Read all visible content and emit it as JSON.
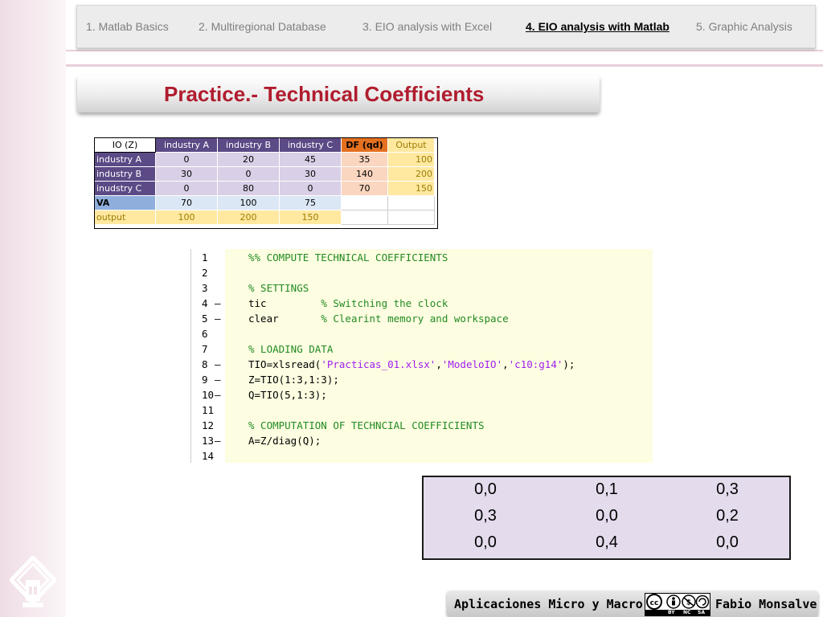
{
  "nav": {
    "items": [
      {
        "label": "1. Matlab Basics",
        "active": false
      },
      {
        "label": "2. Multiregional Database",
        "active": false
      },
      {
        "label": "3. EIO analysis with Excel",
        "active": false
      },
      {
        "label": "4. EIO analysis with Matlab",
        "active": true
      },
      {
        "label": "5. Graphic Analysis",
        "active": false
      }
    ]
  },
  "title": "Practice.- Technical Coefficients",
  "io_table": {
    "header": [
      "IO (Z)",
      "industry A",
      "industry B",
      "industry C",
      "DF (qd)",
      "Output"
    ],
    "rows": [
      {
        "label": "industry A",
        "cells": [
          "0",
          "20",
          "45",
          "35",
          "100"
        ]
      },
      {
        "label": "industry B",
        "cells": [
          "30",
          "0",
          "30",
          "140",
          "200"
        ]
      },
      {
        "label": "inudstry C",
        "cells": [
          "0",
          "80",
          "0",
          "70",
          "150"
        ]
      },
      {
        "label": "VA",
        "cells": [
          "70",
          "100",
          "75",
          "",
          ""
        ]
      },
      {
        "label": "output",
        "cells": [
          "100",
          "200",
          "150",
          "",
          ""
        ]
      }
    ]
  },
  "code": {
    "lines": [
      {
        "n": "1",
        "dash": "",
        "parts": [
          [
            "comment",
            "%% COMPUTE TECHNICAL COEFFICIENTS"
          ]
        ]
      },
      {
        "n": "2",
        "dash": "",
        "parts": []
      },
      {
        "n": "3",
        "dash": "",
        "parts": [
          [
            "comment",
            "% SETTINGS"
          ]
        ]
      },
      {
        "n": "4",
        "dash": "–",
        "parts": [
          [
            "code",
            "tic         "
          ],
          [
            "comment",
            "% Switching the clock"
          ]
        ]
      },
      {
        "n": "5",
        "dash": "–",
        "parts": [
          [
            "code",
            "clear       "
          ],
          [
            "comment",
            "% Clearint memory and workspace"
          ]
        ]
      },
      {
        "n": "6",
        "dash": "",
        "parts": []
      },
      {
        "n": "7",
        "dash": "",
        "parts": [
          [
            "comment",
            "% LOADING DATA"
          ]
        ]
      },
      {
        "n": "8",
        "dash": "–",
        "parts": [
          [
            "code",
            "TIO=xlsread("
          ],
          [
            "str",
            "'Practicas_01.xlsx'"
          ],
          [
            "code",
            ","
          ],
          [
            "str",
            "'ModeloIO'"
          ],
          [
            "code",
            ","
          ],
          [
            "str",
            "'c10:g14'"
          ],
          [
            "code",
            ");"
          ]
        ]
      },
      {
        "n": "9",
        "dash": "–",
        "parts": [
          [
            "code",
            "Z=TIO(1:3,1:3);"
          ]
        ]
      },
      {
        "n": "10",
        "dash": "–",
        "parts": [
          [
            "code",
            "Q=TIO(5,1:3);"
          ]
        ]
      },
      {
        "n": "11",
        "dash": "",
        "parts": []
      },
      {
        "n": "12",
        "dash": "",
        "parts": [
          [
            "comment",
            "% COMPUTATION OF TECHNCIAL COEFFICIENTS"
          ]
        ]
      },
      {
        "n": "13",
        "dash": "–",
        "parts": [
          [
            "code",
            "A=Z/diag(Q);"
          ]
        ]
      },
      {
        "n": "14",
        "dash": "",
        "parts": []
      }
    ]
  },
  "result": {
    "rows": [
      [
        "0,0",
        "0,1",
        "0,3"
      ],
      [
        "0,3",
        "0,0",
        "0,2"
      ],
      [
        "0,0",
        "0,4",
        "0,0"
      ]
    ]
  },
  "footer": {
    "left_text": "Aplicaciones Micro y Macro",
    "right_text": "Fabio Monsalve",
    "license_labels": [
      "BY",
      "NC",
      "SA"
    ]
  },
  "colors": {
    "title": "#b01c2e",
    "row_label_bg": "#5c4a86",
    "matrix_bg": "#d9cfe6",
    "df_header_bg": "#e5701f",
    "df_bg": "#fad5bf",
    "output_bg": "#ffe8a0",
    "va_bg": "#8faedb",
    "va_row_bg": "#dce7f5"
  }
}
